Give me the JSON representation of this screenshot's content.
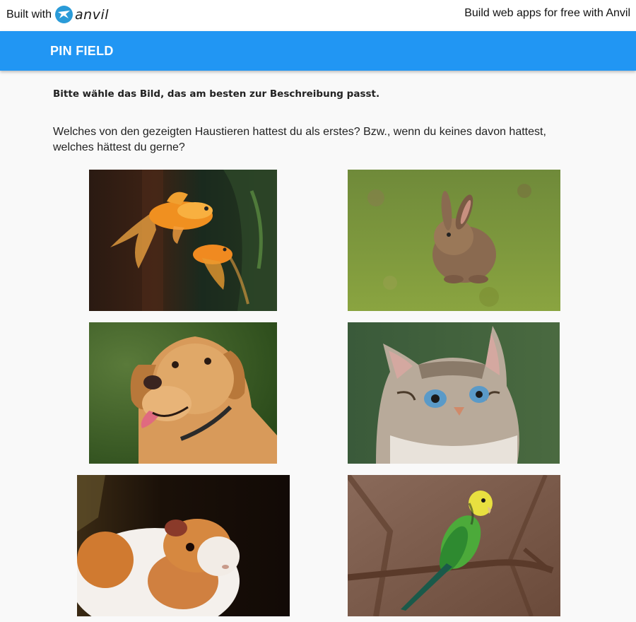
{
  "topbar": {
    "built_with": "Built with",
    "logo_text": "anvil",
    "tagline": "Build web apps for free with Anvil"
  },
  "app": {
    "title": "PIN FIELD"
  },
  "content": {
    "instruction": "Bitte wähle das Bild, das am besten zur Beschreibung passt.",
    "question": "Welches von den gezeigten Haustieren hattest du als erstes? Bzw., wenn du keines davon hattest, welches hättest du gerne?"
  },
  "choices": [
    {
      "animal": "goldfish"
    },
    {
      "animal": "rabbit"
    },
    {
      "animal": "dog"
    },
    {
      "animal": "cat"
    },
    {
      "animal": "guinea-pig"
    },
    {
      "animal": "budgie"
    }
  ],
  "colors": {
    "appbar": "#2196f3",
    "page_background": "#f9f9f9",
    "logo_accent": "#2a9bd8"
  }
}
